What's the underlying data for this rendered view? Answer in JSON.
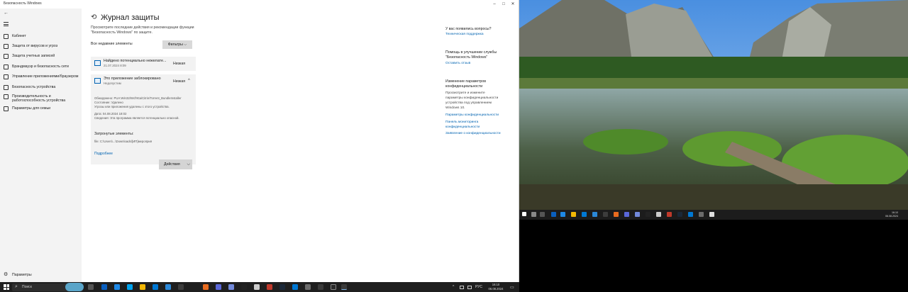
{
  "window": {
    "title": "Безопасность Windows",
    "minimize_glyph": "–",
    "maximize_glyph": "□",
    "close_glyph": "✕"
  },
  "sidebar": {
    "back_glyph": "←",
    "items": [
      {
        "label": "Кабинет",
        "icon": "home-icon"
      },
      {
        "label": "Защита от вирусов и угроз",
        "icon": "shield-virus-icon"
      },
      {
        "label": "Защита учетных записей",
        "icon": "account-icon"
      },
      {
        "label": "Брандмауэр и безопасность сети",
        "icon": "network-icon"
      },
      {
        "label": "Управление приложениями/браузером",
        "icon": "app-browser-icon"
      },
      {
        "label": "Безопасность устройства",
        "icon": "device-security-icon"
      },
      {
        "label": "Производительность и",
        "label2": "работоспособность устройства",
        "icon": "heart-icon"
      },
      {
        "label": "Параметры для семьи",
        "icon": "family-icon"
      }
    ],
    "settings_label": "Параметры",
    "settings_glyph": "⚙"
  },
  "main": {
    "title": "Журнал защиты",
    "title_glyph": "⟲",
    "description": "Просмотрите последние действия и рекомендации функции \"Безопасность Windows\" по защите.",
    "filter_label": "Все недавние элементы",
    "filters_button": "Фильтры",
    "filters_glyph": "⌵",
    "items": [
      {
        "title": "Найдено потенциально нежелате...",
        "date": "21.07.2024 8:09",
        "severity": "Низкая"
      },
      {
        "title": "Это приложение заблокировано",
        "subtitle": "Недопустим",
        "severity": "Низкая",
        "chevron": "^",
        "details": [
          "Обнаружено: PUA:Win32/Wcf!Kta/Citrin/Torrent_BundleInstaller",
          "Состояние: Удалено",
          "Угрозы или приложения удалены с этого устройства.",
          "Дата: 04.08.2024 18:02",
          "Сведения: Эта программа является потенциально опасной."
        ],
        "affected_heading": "Затронутые элементы:",
        "affected_file": "file: C:\\Users\\...\\Downloads\\[ИП]мероприя",
        "more_link": "Подробнее",
        "actions_button": "Действия",
        "actions_glyph": "⌵"
      }
    ]
  },
  "right_panel": {
    "q_heading": "У вас появились вопросы?",
    "q_link": "Техническая поддержка",
    "help_heading": "Помощь в улучшении службы",
    "help_heading2": "\"Безопасность Windows\"",
    "help_link": "Оставить отзыв",
    "privacy_heading": "Изменение параметров",
    "privacy_heading2": "конфиденциальности",
    "privacy_text": [
      "Просмотрите и измените",
      "параметры конфиденциальности",
      "устройства под управлением",
      "Windows 10."
    ],
    "privacy_links": [
      "Параметры конфиденциальности",
      "Панель мониторинга",
      "конфиденциальности",
      "Заявление о конфиденциальности"
    ]
  },
  "taskbar": {
    "search_placeholder": "Поиск",
    "search_glyph": "⌕",
    "lang": "РУС",
    "time": "16:10",
    "date": "06.08.2024",
    "notif_glyph": "▭",
    "tray_chevron": "^",
    "icon_colors": [
      "#0a5fbf",
      "#1e88e5",
      "#00a2ed",
      "#f2b705",
      "#0078d4",
      "#2b88d8",
      "#3c3c3c",
      "#e86b1f",
      "#5a67d8",
      "#7289da",
      "#222222",
      "#cccccc",
      "#c0392b",
      "#1b2838",
      "#0078d4",
      "#6b6b6b",
      "#3a3a3a"
    ]
  },
  "second_taskbar": {
    "time": "16:10",
    "date": "06.08.2024"
  },
  "colors": {
    "accent": "#0063b1",
    "sidebar_bg": "#f3f3f3",
    "taskbar_bg": "#1f1f1f"
  }
}
